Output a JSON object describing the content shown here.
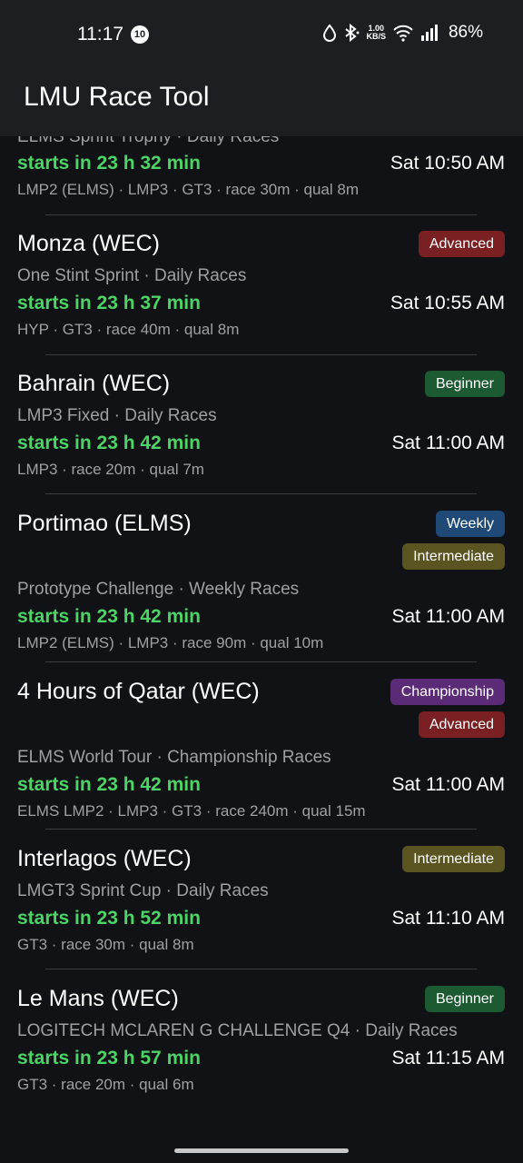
{
  "status_bar": {
    "time": "11:17",
    "notification_count": "10",
    "net_speed_value": "1.00",
    "net_speed_unit": "KB/S",
    "battery": "86%"
  },
  "app_bar": {
    "title": "LMU Race Tool"
  },
  "colors": {
    "background": "#111216",
    "countdown_green": "#4cd466",
    "advanced": "#7a2022",
    "beginner": "#1c5a31",
    "weekly": "#1f4a78",
    "intermediate": "#5a5420",
    "championship": "#5c2b78"
  },
  "races": [
    {
      "name": "",
      "series": "ELMS Sprint Trophy · Daily Races",
      "countdown": "starts in 23 h 32 min",
      "start_time": "Sat 10:50 AM",
      "classes": "LMP2 (ELMS) · LMP3 · GT3 · race 30m · qual 8m",
      "badges": []
    },
    {
      "name": "Monza (WEC)",
      "series": "One Stint Sprint · Daily Races",
      "countdown": "starts in 23 h 37 min",
      "start_time": "Sat 10:55 AM",
      "classes": "HYP · GT3 · race 40m · qual 8m",
      "badges": [
        "Advanced"
      ]
    },
    {
      "name": "Bahrain (WEC)",
      "series": "LMP3 Fixed · Daily Races",
      "countdown": "starts in 23 h 42 min",
      "start_time": "Sat 11:00 AM",
      "classes": "LMP3 · race 20m · qual 7m",
      "badges": [
        "Beginner"
      ]
    },
    {
      "name": "Portimao (ELMS)",
      "series": "Prototype Challenge · Weekly Races",
      "countdown": "starts in 23 h 42 min",
      "start_time": "Sat 11:00 AM",
      "classes": "LMP2 (ELMS) · LMP3 · race 90m · qual 10m",
      "badges": [
        "Weekly",
        "Intermediate"
      ]
    },
    {
      "name": "4 Hours of Qatar (WEC)",
      "series": "ELMS World Tour · Championship Races",
      "countdown": "starts in 23 h 42 min",
      "start_time": "Sat 11:00 AM",
      "classes": "ELMS LMP2 · LMP3 · GT3 · race 240m · qual 15m",
      "badges": [
        "Championship",
        "Advanced"
      ]
    },
    {
      "name": "Interlagos (WEC)",
      "series": "LMGT3 Sprint Cup · Daily Races",
      "countdown": "starts in 23 h 52 min",
      "start_time": "Sat 11:10 AM",
      "classes": "GT3 · race 30m · qual 8m",
      "badges": [
        "Intermediate"
      ]
    },
    {
      "name": "Le Mans (WEC)",
      "series": "LOGITECH MCLAREN G CHALLENGE Q4 · Daily Races",
      "countdown": "starts in 23 h 57 min",
      "start_time": "Sat 11:15 AM",
      "classes": "GT3 · race 20m · qual 6m",
      "badges": [
        "Beginner"
      ]
    }
  ]
}
